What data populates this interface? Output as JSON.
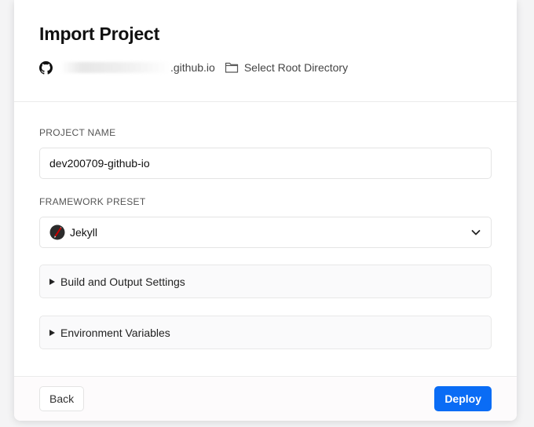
{
  "header": {
    "title": "Import Project",
    "repo_suffix": ".github.io",
    "select_root_label": "Select Root Directory"
  },
  "form": {
    "project_name_label": "PROJECT NAME",
    "project_name_value": "dev200709-github-io",
    "framework_label": "FRAMEWORK PRESET",
    "framework_value": "Jekyll",
    "build_settings_label": "Build and Output Settings",
    "env_vars_label": "Environment Variables"
  },
  "footer": {
    "back_label": "Back",
    "deploy_label": "Deploy"
  },
  "icons": {
    "repo": "github-icon",
    "folder": "folder-icon",
    "framework": "jekyll-icon",
    "dropdown": "chevron-down-icon"
  },
  "colors": {
    "accent": "#0a6cf5",
    "jekyll_red": "#cc0000"
  }
}
